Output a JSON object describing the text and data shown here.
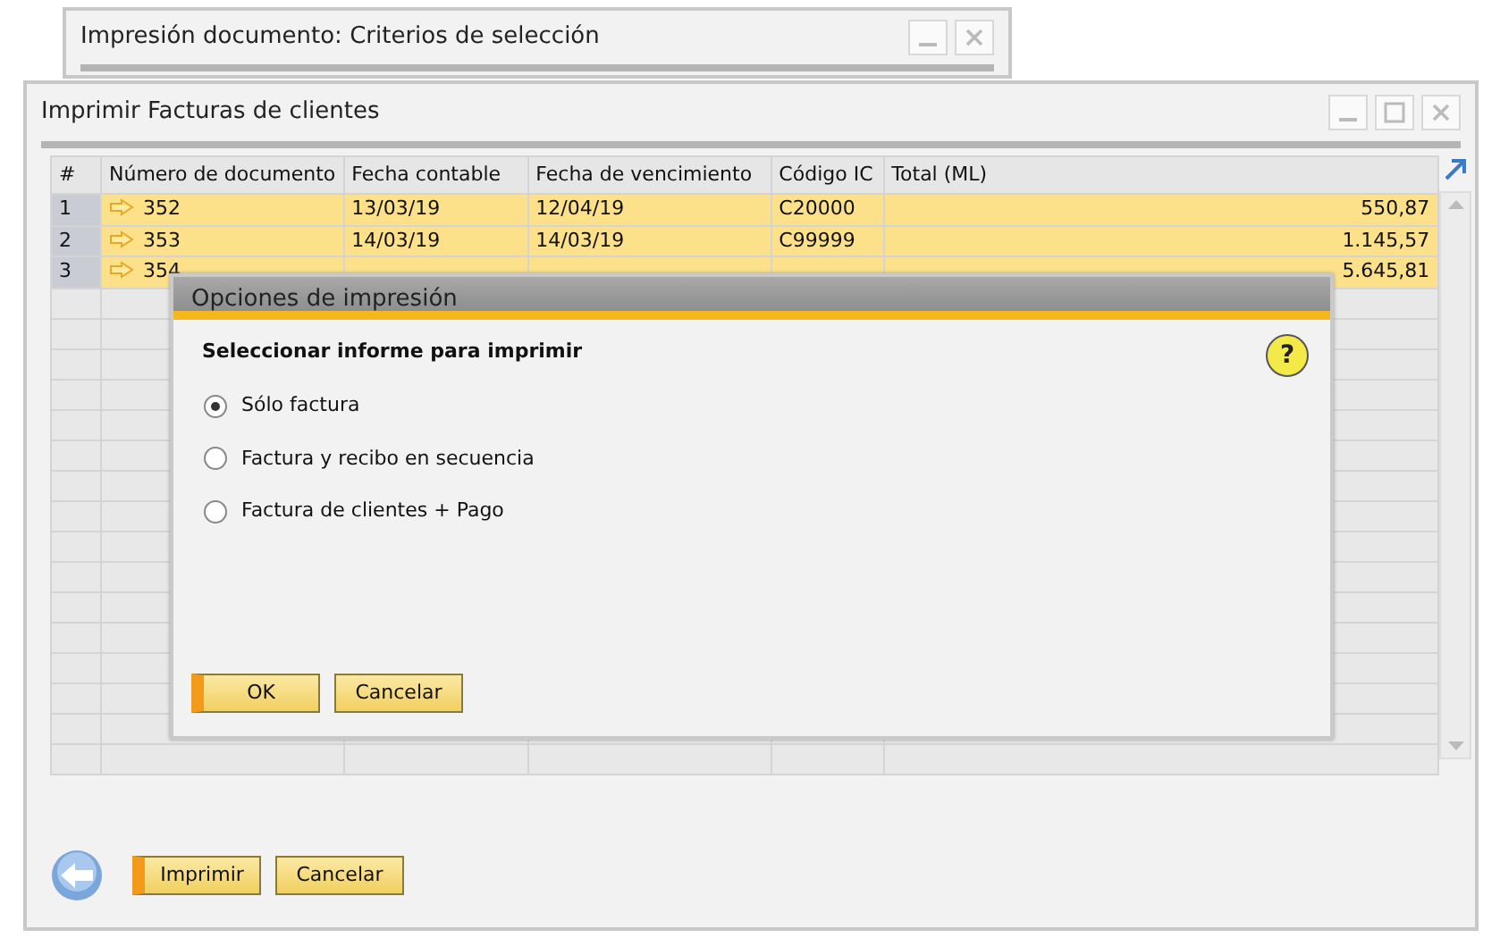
{
  "background_window": {
    "title": "Impresión documento: Criterios de selección"
  },
  "main_window": {
    "title": "Imprimir Facturas de clientes",
    "table": {
      "columns": [
        "#",
        "Número de documento",
        "Fecha contable",
        "Fecha de vencimiento",
        "Código IC",
        "Total (ML)"
      ],
      "rows": [
        {
          "number": "1",
          "document": "352",
          "posting_date": "13/03/19",
          "due_date": "12/04/19",
          "bp_code": "C20000",
          "total": "550,87",
          "selected": true
        },
        {
          "number": "2",
          "document": "353",
          "posting_date": "14/03/19",
          "due_date": "14/03/19",
          "bp_code": "C99999",
          "total": "1.145,57",
          "selected": true
        },
        {
          "number": "3",
          "document": "354",
          "total": "5.645,81",
          "selected": true
        }
      ]
    },
    "buttons": [
      {
        "label": "Imprimir",
        "default": true
      },
      {
        "label": "Cancelar",
        "default": false
      }
    ]
  },
  "dialog": {
    "title": "Opciones de impresión",
    "heading": "Seleccionar informe para imprimir",
    "help": "?",
    "options": [
      {
        "label": "Sólo factura",
        "selected": true
      },
      {
        "label": "Factura y recibo en secuencia",
        "selected": false
      },
      {
        "label": "Factura de clientes + Pago",
        "selected": false
      }
    ],
    "buttons": [
      {
        "label": "OK",
        "default": true
      },
      {
        "label": "Cancelar",
        "default": false
      }
    ]
  }
}
